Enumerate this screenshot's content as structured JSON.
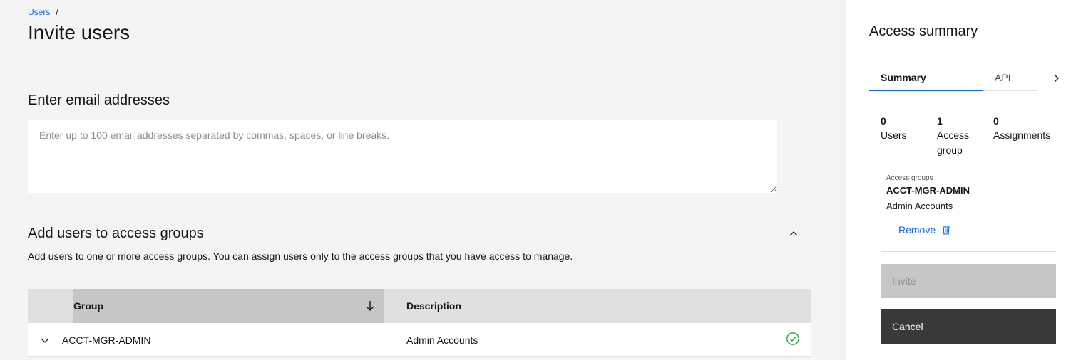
{
  "breadcrumb": {
    "link": "Users",
    "separator": "/"
  },
  "page": {
    "title": "Invite users"
  },
  "email": {
    "heading": "Enter email addresses",
    "value": "",
    "placeholder": "Enter up to 100 email addresses separated by commas, spaces, or line breaks."
  },
  "access_groups": {
    "heading": "Add users to access groups",
    "description": "Add users to one or more access groups. You can assign users only to the access groups that you have access to manage.",
    "table": {
      "headers": {
        "group": "Group",
        "description": "Description"
      },
      "sort": "descending",
      "rows": [
        {
          "group": "ACCT-MGR-ADMIN",
          "description": "Admin Accounts",
          "selected": true
        }
      ]
    }
  },
  "panel": {
    "title": "Access summary",
    "tabs": [
      {
        "label": "Summary",
        "active": true
      },
      {
        "label": "API",
        "active": false
      }
    ],
    "stats": [
      {
        "value": "0",
        "label": "Users"
      },
      {
        "value": "1",
        "label": "Access group"
      },
      {
        "value": "0",
        "label": "Assignments"
      }
    ],
    "summary": {
      "label": "Access groups",
      "name": "ACCT-MGR-ADMIN",
      "description": "Admin Accounts",
      "remove": "Remove"
    },
    "invite": "Invite",
    "cancel": "Cancel"
  },
  "colors": {
    "accent": "#0f62fe",
    "success": "#24a148",
    "dark_button": "#393939",
    "disabled_button": "#c6c6c6"
  },
  "icons": [
    "chevron-up-icon",
    "sort-arrow-down-icon",
    "chevron-down-icon",
    "checkmark-circle-icon",
    "chevron-right-icon",
    "trash-icon"
  ]
}
